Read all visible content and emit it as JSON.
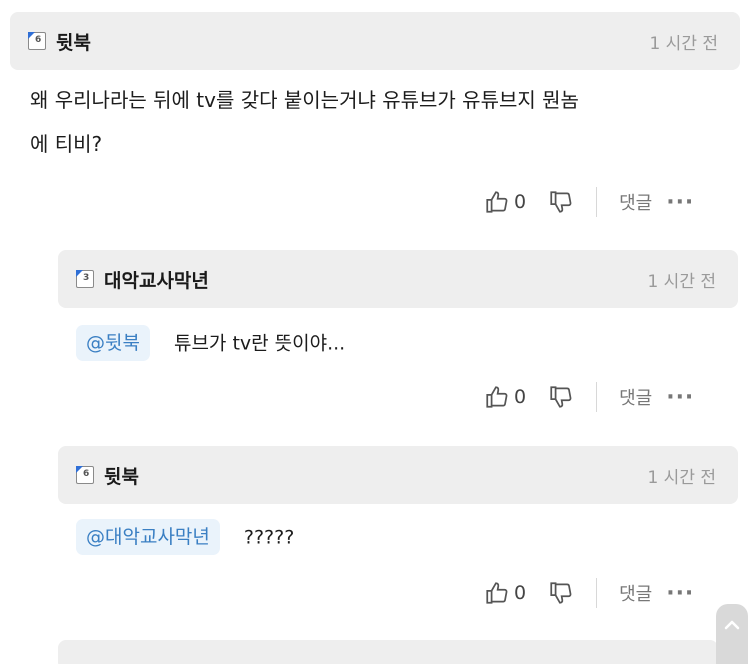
{
  "comments": [
    {
      "level": "6",
      "nickname": "뒷북",
      "time": "1 시간 전",
      "body_line1": "왜 우리나라는 뒤에 tv를 갖다 붙이는거냐 유튜브가 유튜브지 뭔놈",
      "body_line2": "에 티비?",
      "likes": "0",
      "reply_label": "댓글",
      "more": "···"
    },
    {
      "level": "3",
      "nickname": "대악교사막년",
      "time": "1 시간 전",
      "mention": "@뒷북",
      "body": "튜브가 tv란 뜻이야...",
      "likes": "0",
      "reply_label": "댓글",
      "more": "···"
    },
    {
      "level": "6",
      "nickname": "뒷북",
      "time": "1 시간 전",
      "mention": "@대악교사막년",
      "body": "?????",
      "likes": "0",
      "reply_label": "댓글",
      "more": "···"
    }
  ],
  "icons": {
    "like": "thumbs-up-icon",
    "dislike": "thumbs-down-icon",
    "more": "more-dots-icon",
    "scroll": "chevron-up-icon"
  },
  "colors": {
    "header_bg": "#eeeeee",
    "mention_bg": "#eaf3fb",
    "mention_text": "#3a7fc3",
    "badge_accent": "#2f6fd6"
  }
}
